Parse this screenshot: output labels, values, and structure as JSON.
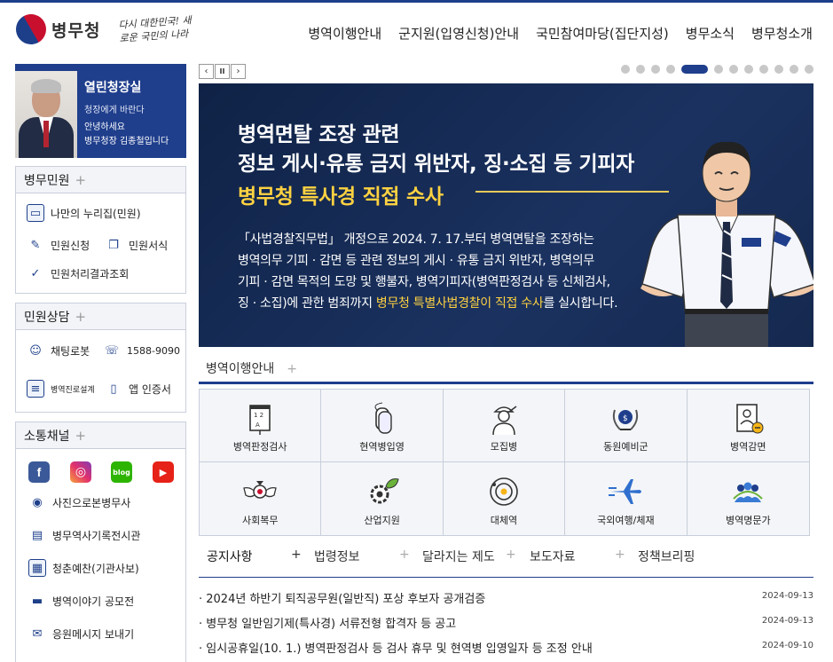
{
  "header": {
    "logo_text": "병무청",
    "slogan": "다시 대한민국! 새로운 국민의 나라",
    "nav": [
      "병역이행안내",
      "군지원(입영신청)안내",
      "국민참여마당(집단지성)",
      "병무소식",
      "병무청소개"
    ]
  },
  "ceo": {
    "title": "열린청장실",
    "sub": "청장에게 바란다",
    "greet1": "안녕하세요",
    "greet2": "병무청장 김종철입니다"
  },
  "civil": {
    "title": "병무민원",
    "items": [
      "나만의 누리집(민원)",
      "민원신청",
      "민원서식",
      "민원처리결과조회"
    ]
  },
  "consult": {
    "title": "민원상담",
    "items": [
      "채팅로봇",
      "1588-9090",
      "병역진로설계",
      "앱 인증서"
    ]
  },
  "sns": {
    "title": "소통채널",
    "icons": [
      "facebook-icon",
      "instagram-icon",
      "blog-icon",
      "youtube-icon"
    ],
    "blog_label": "blog",
    "items": [
      "사진으로본병무사",
      "병무역사기록전시관",
      "청춘예찬(기관사보)",
      "병역이야기 공모전",
      "응원메시지 보내기"
    ]
  },
  "slider": {
    "prev": "‹",
    "pause": "II",
    "next": "›",
    "dot_count": 12,
    "active_dot": 5
  },
  "banner": {
    "line1": "병역면탈 조장 관련",
    "line2": "정보 게시·유통 금지 위반자, 징·소집 등 기피자",
    "line3": "병무청 특사경 직접 수사",
    "body_a": "「사법경찰직무법」 개정으로 2024. 7. 17.부터 병역면탈을 조장하는",
    "body_b": "병역의무 기피 · 감면 등 관련 정보의 게시 · 유통 금지 위반자, 병역의무",
    "body_c": "기피 · 감면 목적의 도망 및 행불자, 병역기피자(병역판정검사 등 신체검사,",
    "body_d": "징 · 소집)에 관한 범죄까지 ",
    "body_hl": "병무청 특별사법경찰이 직접 수사",
    "body_e": "를 실시합니다."
  },
  "service": {
    "title": "병역이행안내",
    "items": [
      "병역판정검사",
      "현역병입영",
      "모집병",
      "동원예비군",
      "병역감면",
      "사회복무",
      "산업지원",
      "대체역",
      "국외여행/체재",
      "병역명문가"
    ]
  },
  "notice": {
    "tabs": [
      "공지사항",
      "법령정보",
      "달라지는 제도",
      "보도자료",
      "정책브리핑"
    ],
    "rows": [
      {
        "title": "2024년 하반기 퇴직공무원(일반직) 포상 후보자 공개검증",
        "date": "2024-09-13"
      },
      {
        "title": "병무청 일반임기제(특사경) 서류전형 합격자 등 공고",
        "date": "2024-09-13"
      },
      {
        "title": "임시공휴일(10. 1.) 병역판정검사 등 검사 휴무 및 현역병 입영일자 등 조정 안내",
        "date": "2024-09-10"
      }
    ]
  },
  "colors": {
    "brand": "#1f3e8c",
    "accent": "#ffd241"
  }
}
